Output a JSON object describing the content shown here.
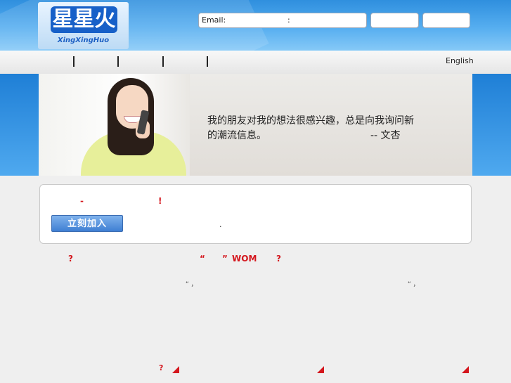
{
  "brand": {
    "logo_text": "星星火",
    "wordmark": "XingXingHuo"
  },
  "login": {
    "email_label": "Email:",
    "colon": ":"
  },
  "nav": {
    "separators": [
      "|",
      "|",
      "|",
      "|"
    ],
    "language": "English"
  },
  "banner": {
    "quote_line1": "我的朋友对我的想法很感兴趣，总是向我询问新",
    "quote_line2": "的潮流信息。",
    "quote_author": "-- 文杏"
  },
  "join": {
    "dash": "-",
    "exclaim": "!",
    "button_label": "立刻加入",
    "dot": "."
  },
  "features": {
    "q1": "?",
    "quote_open": "“",
    "quote_close": "”",
    "wom": "WOM",
    "q2": "?",
    "mark1": "“ ，",
    "mark2": "“ ，",
    "q3": "?"
  },
  "colors": {
    "accent_red": "#d4161d",
    "sky_blue": "#2f8fde",
    "button_blue": "#3f7fd3"
  }
}
